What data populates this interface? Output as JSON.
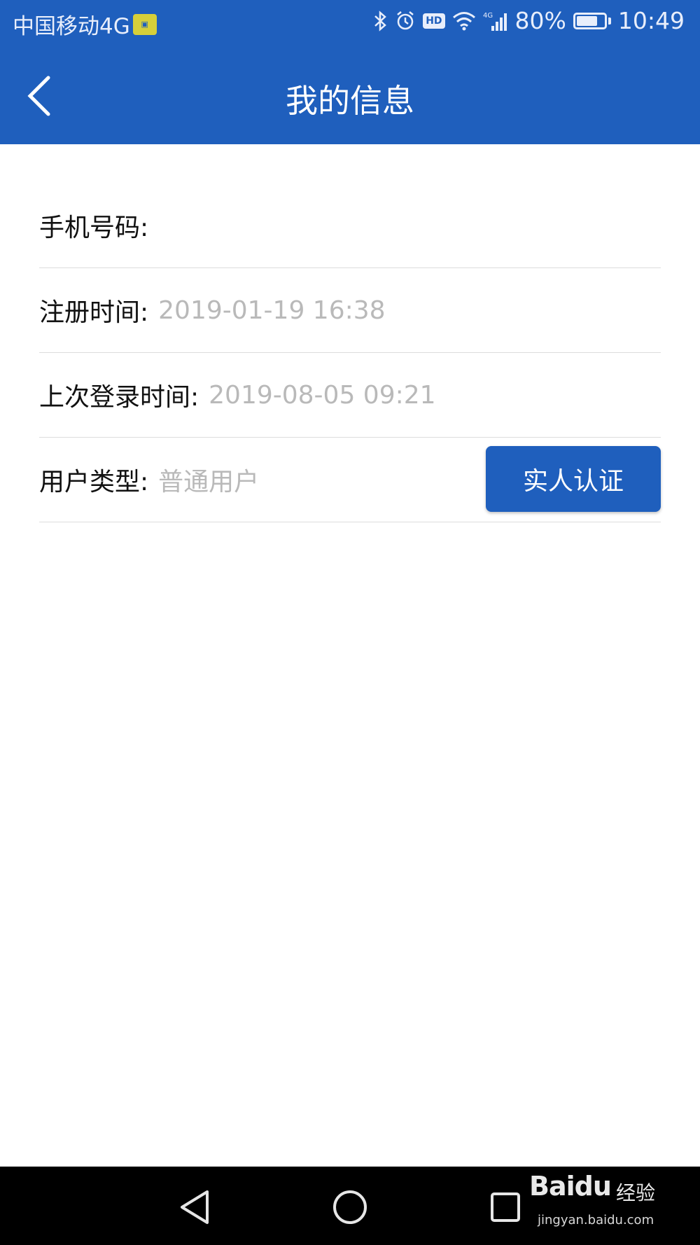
{
  "status_bar": {
    "carrier": "中国移动4G",
    "signal_label": "4G",
    "hd_label": "HD",
    "battery_percent": "80%",
    "battery_level": 0.8,
    "time": "10:49"
  },
  "app_bar": {
    "title": "我的信息",
    "back_icon": "chevron-left-icon"
  },
  "rows": [
    {
      "label": "手机号码:",
      "value": ""
    },
    {
      "label": "注册时间:",
      "value": "2019-01-19 16:38"
    },
    {
      "label": "上次登录时间:",
      "value": "2019-08-05 09:21"
    },
    {
      "label": "用户类型:",
      "value": "普通用户"
    }
  ],
  "verify_button": {
    "label": "实人认证"
  },
  "nav_bar": {
    "back_icon": "triangle-back-icon",
    "home_icon": "circle-home-icon",
    "recents_icon": "square-recents-icon"
  },
  "watermark": {
    "brand": "Baidu",
    "name": "经验",
    "url": "jingyan.baidu.com"
  },
  "colors": {
    "primary": "#1f5fbd",
    "value_text": "#b9b9b9",
    "divider": "#dcdcdc"
  }
}
